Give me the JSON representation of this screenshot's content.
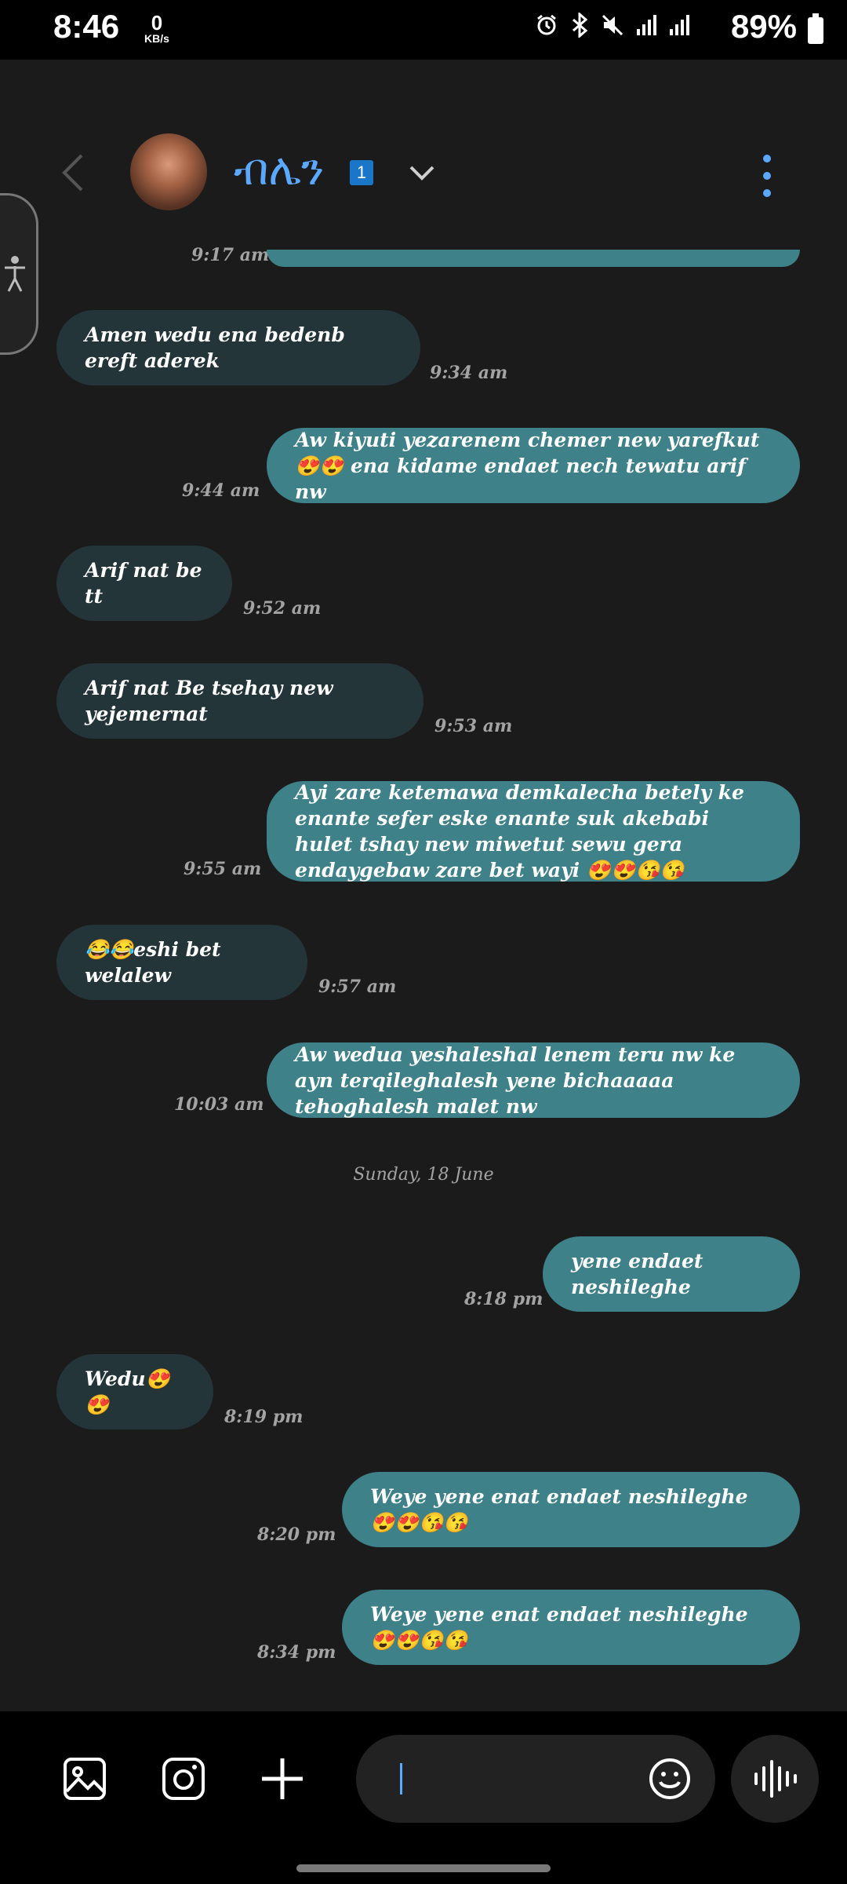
{
  "status_bar": {
    "time": "8:46",
    "speed_value": "0",
    "speed_unit": "KB/s",
    "battery": "89%",
    "icons": [
      "alarm-icon",
      "bluetooth-icon",
      "mute-icon",
      "signal-icon",
      "signal-icon"
    ]
  },
  "header": {
    "contact_name": "ብሌን",
    "badge": "1",
    "avatar": "contact-avatar"
  },
  "messages": [
    {
      "dir": "in",
      "text": "",
      "time": "9:17 am"
    },
    {
      "dir": "in",
      "text": "Amen wedu ena bedenb ereft aderek",
      "time": "9:34 am"
    },
    {
      "dir": "out",
      "text": "Aw kiyuti yezarenem chemer new yarefkut 😍😍 ena kidame endaet nech tewatu arif nw",
      "time": "9:44 am"
    },
    {
      "dir": "in",
      "text": "Arif nat be tt",
      "time": "9:52 am"
    },
    {
      "dir": "in",
      "text": "Arif nat Be tsehay new yejemernat",
      "time": "9:53 am"
    },
    {
      "dir": "out",
      "text": "Ayi zare ketemawa demkalecha betely ke enante sefer eske enante suk akebabi hulet tshay new miwetut sewu gera endaygebaw zare bet wayi 😍😍😘😘",
      "time": "9:55 am"
    },
    {
      "dir": "in",
      "text": "😂😂eshi  bet welalew",
      "time": "9:57 am"
    },
    {
      "dir": "out",
      "text": "Aw wedua yeshaleshal lenem teru nw ke ayn terqileghalesh yene bichaaaaa tehoghalesh malet nw",
      "time": "10:03 am"
    },
    {
      "dir": "date",
      "text": "Sunday, 18 June"
    },
    {
      "dir": "out",
      "text": "yene endaet neshileghe",
      "time": "8:18 pm"
    },
    {
      "dir": "in",
      "text": "Wedu😍😍",
      "time": "8:19 pm"
    },
    {
      "dir": "out",
      "text": "Weye yene enat endaet neshileghe 😍😍😘😘",
      "time": "8:20 pm"
    },
    {
      "dir": "out",
      "text": "Weye yene enat endaet neshileghe 😍😍😘😘",
      "time": "8:34 pm"
    }
  ],
  "colors": {
    "background": "#1b1b1b",
    "incoming_bubble": "#233538",
    "outgoing_bubble": "#3e8188",
    "accent": "#5aa9ff"
  },
  "composer": {
    "placeholder": ""
  }
}
